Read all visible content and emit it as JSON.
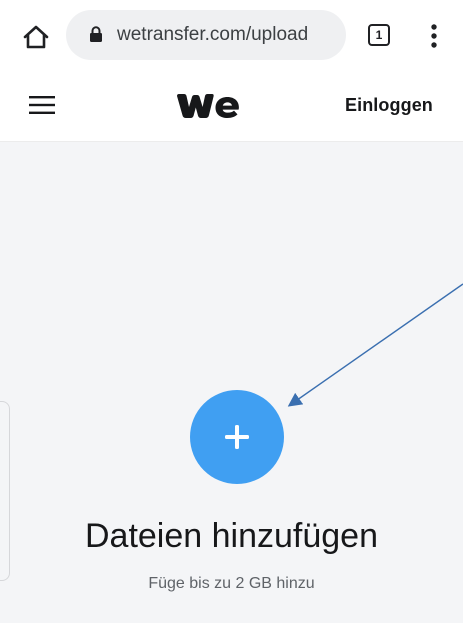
{
  "browser": {
    "url": "wetransfer.com/upload",
    "tab_count": "1",
    "home_icon": "home-icon",
    "lock_icon": "lock-icon",
    "menu_icon": "vertical-dots-icon"
  },
  "header": {
    "menu_icon": "hamburger-icon",
    "logo": "we",
    "login_label": "Einloggen"
  },
  "main": {
    "add_icon": "plus-icon",
    "title": "Dateien hinzufügen",
    "subtitle": "Füge bis zu 2 GB hinzu"
  },
  "colors": {
    "accent": "#409ff2",
    "background": "#f4f5f7",
    "annotation_arrow": "#3a6fb0"
  }
}
